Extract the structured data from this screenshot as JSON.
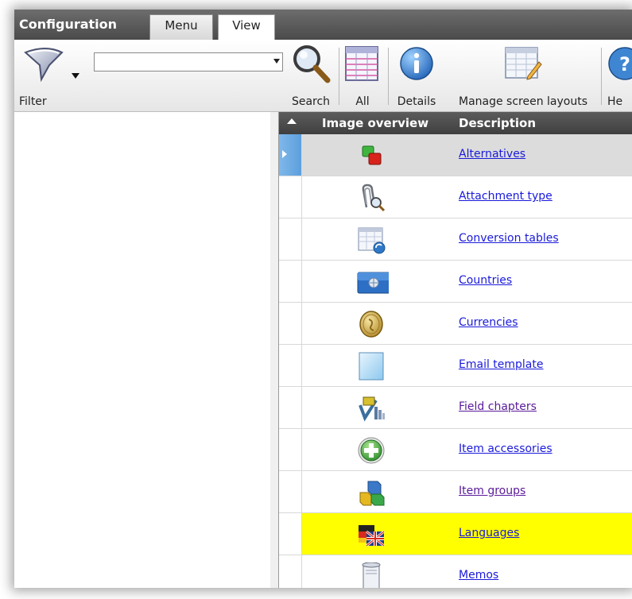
{
  "app": {
    "title": "Configuration"
  },
  "tabs": [
    {
      "label": "Menu"
    },
    {
      "label": "View"
    }
  ],
  "ribbon": {
    "filter_label": "Filter",
    "filter_value": "",
    "search_label": "Search",
    "all_label": "All",
    "details_label": "Details",
    "manage_label": "Manage screen layouts",
    "help_label": "He"
  },
  "grid": {
    "columns": [
      "Image overview",
      "Description"
    ],
    "rows": [
      {
        "icon": "alternatives-icon",
        "description": "Alternatives",
        "selected": true
      },
      {
        "icon": "paperclip-search-icon",
        "description": "Attachment type"
      },
      {
        "icon": "table-refresh-icon",
        "description": "Conversion tables"
      },
      {
        "icon": "globe-card-icon",
        "description": "Countries"
      },
      {
        "icon": "coin-icon",
        "description": "Currencies"
      },
      {
        "icon": "email-template-icon",
        "description": "Email template"
      },
      {
        "icon": "field-chapters-icon",
        "description": "Field chapters",
        "visited": true
      },
      {
        "icon": "add-circle-icon",
        "description": "Item accessories"
      },
      {
        "icon": "cubes-icon",
        "description": "Item groups",
        "visited": true
      },
      {
        "icon": "flags-icon",
        "description": "Languages",
        "highlighted": true
      },
      {
        "icon": "scroll-icon",
        "description": "Memos"
      }
    ]
  },
  "colors": {
    "titlebar": "#555555",
    "highlight": "#ffff00",
    "link": "#1a1adb",
    "selection": "#6aaae3"
  }
}
